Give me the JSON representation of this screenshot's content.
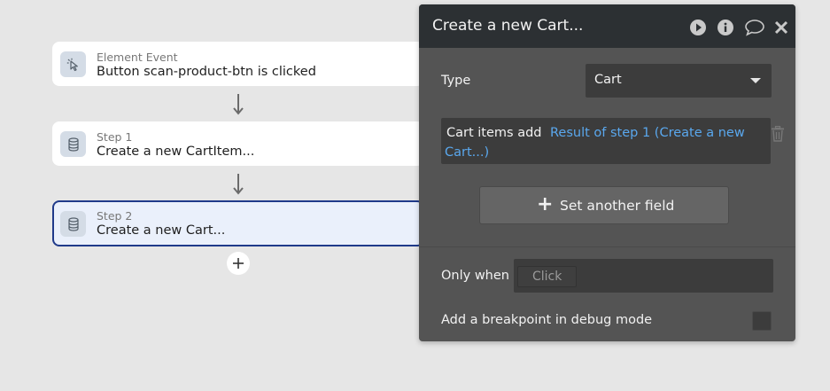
{
  "workflow": {
    "event": {
      "caption": "Element Event",
      "title": "Button scan-product-btn is clicked",
      "icon": "pointer-click-icon"
    },
    "steps": [
      {
        "caption": "Step 1",
        "title": "Create a new CartItem...",
        "icon": "database-icon"
      },
      {
        "caption": "Step 2",
        "title": "Create a new Cart...",
        "icon": "database-icon"
      }
    ],
    "add_step_icon": "plus-icon"
  },
  "panel": {
    "title": "Create a new Cart...",
    "header_icons": [
      "play-icon",
      "info-icon",
      "comment-icon",
      "close-icon"
    ],
    "type": {
      "label": "Type",
      "value": "Cart"
    },
    "fields": [
      {
        "label": "Cart items add",
        "value_line1": "Result of step 1 (Create a new",
        "value_line2": "Cart...)"
      }
    ],
    "set_another_field": {
      "plus": "+",
      "label": "Set another field"
    },
    "only_when": {
      "label": "Only when",
      "placeholder": "Click"
    },
    "breakpoint": {
      "label": "Add a breakpoint in debug mode",
      "checked": false
    }
  },
  "colors": {
    "canvas_bg": "#e6e6e6",
    "panel_bg": "#545454",
    "panel_header_bg": "#2c3033",
    "dynamic_text": "#5aa8ee",
    "selected_border": "#1f3a8a"
  }
}
